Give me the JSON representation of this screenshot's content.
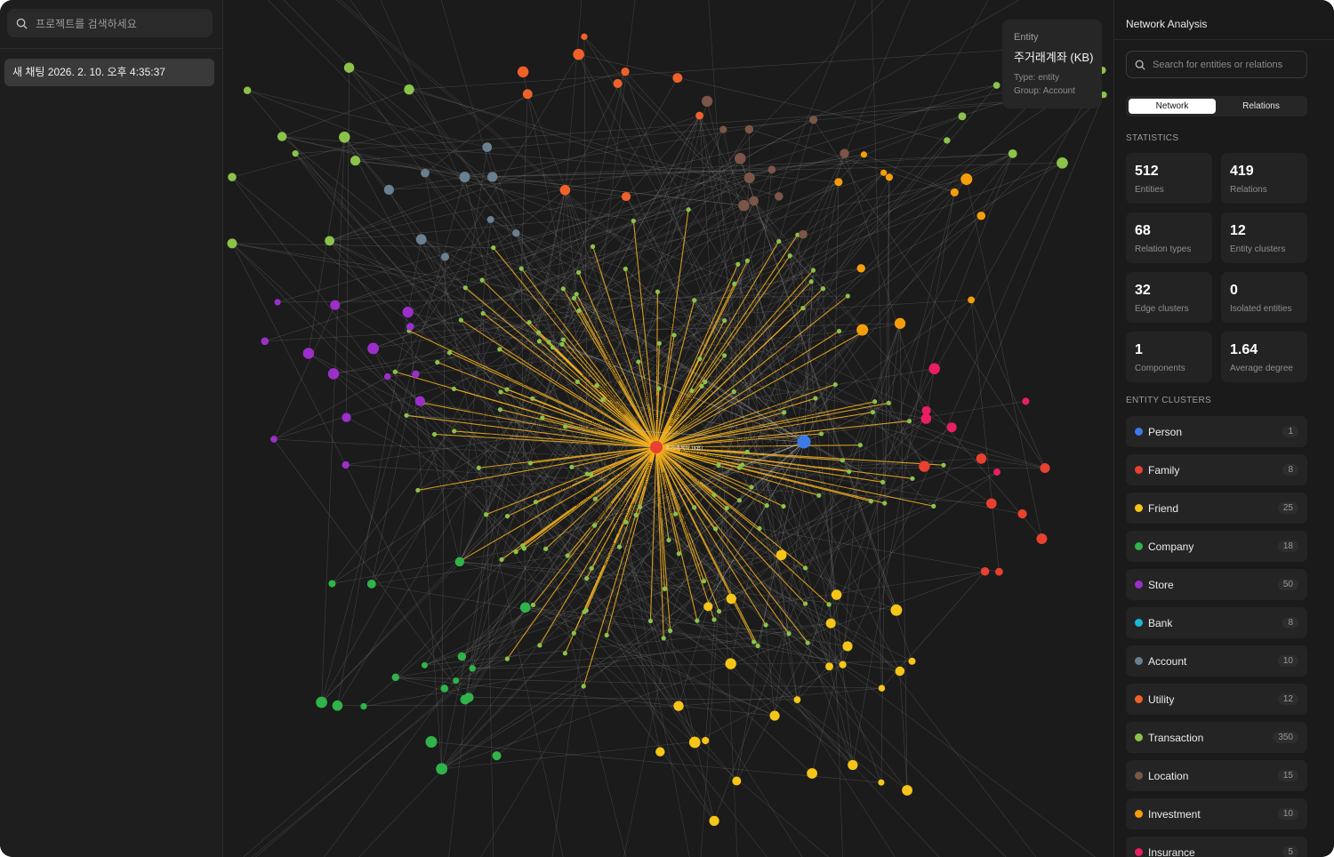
{
  "sidebar": {
    "search_placeholder": "프로젝트를 검색하세요",
    "chat_item": "새 채팅 2026. 2. 10. 오후 4:35:37"
  },
  "graph": {
    "hub_label": "주거래계좌 (KB)",
    "edge_label": "WITHDRAW",
    "tooltip": {
      "heading": "Entity",
      "name": "주거래계좌 (KB)",
      "type": "Type: entity",
      "group": "Group: Account"
    },
    "colors": {
      "edge_highlight": "#f2b01e",
      "edge_default": "#8a8a8a",
      "hub": "#e8412f",
      "selected": "#3b7be8"
    }
  },
  "panel": {
    "title": "Network Analysis",
    "search_placeholder": "Search for entities or relations",
    "tabs": [
      "Network",
      "Relations"
    ],
    "statistics_label": "STATISTICS",
    "stats": [
      {
        "value": "512",
        "label": "Entities"
      },
      {
        "value": "419",
        "label": "Relations"
      },
      {
        "value": "68",
        "label": "Relation types"
      },
      {
        "value": "12",
        "label": "Entity clusters"
      },
      {
        "value": "32",
        "label": "Edge clusters"
      },
      {
        "value": "0",
        "label": "Isolated entities"
      },
      {
        "value": "1",
        "label": "Components"
      },
      {
        "value": "1.64",
        "label": "Average degree"
      }
    ],
    "clusters_label": "ENTITY CLUSTERS",
    "clusters": [
      {
        "name": "Person",
        "count": "1",
        "color": "#3b7be8"
      },
      {
        "name": "Family",
        "count": "8",
        "color": "#e8412f"
      },
      {
        "name": "Friend",
        "count": "25",
        "color": "#f5c518"
      },
      {
        "name": "Company",
        "count": "18",
        "color": "#2fb34a"
      },
      {
        "name": "Store",
        "count": "50",
        "color": "#9b2fc9"
      },
      {
        "name": "Bank",
        "count": "8",
        "color": "#1ab8d4"
      },
      {
        "name": "Account",
        "count": "10",
        "color": "#6a7f8f"
      },
      {
        "name": "Utility",
        "count": "12",
        "color": "#f0612a"
      },
      {
        "name": "Transaction",
        "count": "350",
        "color": "#8bc34a"
      },
      {
        "name": "Location",
        "count": "15",
        "color": "#7a5548"
      },
      {
        "name": "Investment",
        "count": "10",
        "color": "#f59e0b"
      },
      {
        "name": "Insurance",
        "count": "5",
        "color": "#e91e63"
      }
    ]
  }
}
